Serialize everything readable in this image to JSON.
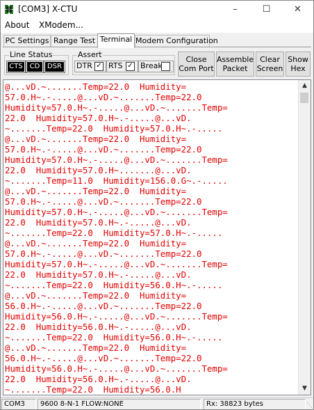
{
  "window": {
    "title": "[COM3] X-CTU"
  },
  "menu": [
    "About",
    "XModem..."
  ],
  "tabs": [
    "PC Settings",
    "Range Test",
    "Terminal",
    "Modem Configuration"
  ],
  "active_tab": "Terminal",
  "line_status": {
    "title": "Line Status",
    "indicators": [
      "CTS",
      "CD",
      "DSR"
    ]
  },
  "assert": {
    "title": "Assert",
    "items": [
      {
        "label": "DTR",
        "checked": true
      },
      {
        "label": "RTS",
        "checked": true
      },
      {
        "label": "Break",
        "checked": false
      }
    ]
  },
  "buttons": {
    "close_com_port": "Close\nCom Port",
    "assemble_packet": "Assemble\nPacket",
    "clear_screen": "Clear\nScreen",
    "show_hex": "Show\nHex"
  },
  "terminal": {
    "lines": [
      "@...vD.~.......Temp=22.0  Humidity=",
      "57.0.H~.-.....@...vD.~.......Temp=22.0",
      "Humidity=57.0.H~.-.....@...vD.~.......Temp=",
      "22.0  Humidity=57.0.H~.-.....@...vD.",
      "~.......Temp=22.0  Humidity=57.0.H~.-.....",
      "@...vD.~.......Temp=22.0  Humidity=",
      "57.0.H~.-.....@...vD.~.......Temp=22.0",
      "Humidity=57.0.H~.-.....@...vD.~.......Temp=",
      "22.0  Humidity=57.0.H~.......@...vD.",
      "~.......Temp=11.0  Humidity=156.0.G~.-.....",
      "@...vD.~.......Temp=22.0  Humidity=",
      "57.0.H~.-.....@...vD.~.......Temp=22.0",
      "Humidity=57.0.H~.-.....@...vD.~.......Temp=",
      "22.0  Humidity=57.0.H~.-.....@...vD.",
      "~.......Temp=22.0  Humidity=57.0.H~.-.....",
      "@...vD.~.......Temp=22.0  Humidity=",
      "57.0.H~.-.....@...vD.~.......Temp=22.0",
      "Humidity=57.0.H~.-.....@...vD.~.......Temp=",
      "22.0  Humidity=57.0.H~.-.....@...vD.",
      "~.......Temp=22.0  Humidity=56.0.H~.-.....",
      "@...vD.~.......Temp=22.0  Humidity=",
      "56.0.H~.-.....@...vD.~.......Temp=22.0",
      "Humidity=56.0.H~.-.....@...vD.~.......Temp=",
      "22.0  Humidity=56.0.H~.-.....@...vD.",
      "~.......Temp=22.0  Humidity=56.0.H~.-.....",
      "@...vD.~.......Temp=22.0  Humidity=",
      "56.0.H~.-.....@...vD.~.......Temp=22.0",
      "Humidity=56.0.H~.-.....@...vD.~.......Temp=",
      "22.0  Humidity=56.0.H~.-.....@...vD.",
      "~.......Temp=22.0  Humidity=56.0.H"
    ],
    "text_color": "#e00000"
  },
  "status": {
    "port": "COM3",
    "settings": "9600 8-N-1  FLOW:NONE",
    "rx": "Rx: 38823 bytes"
  }
}
